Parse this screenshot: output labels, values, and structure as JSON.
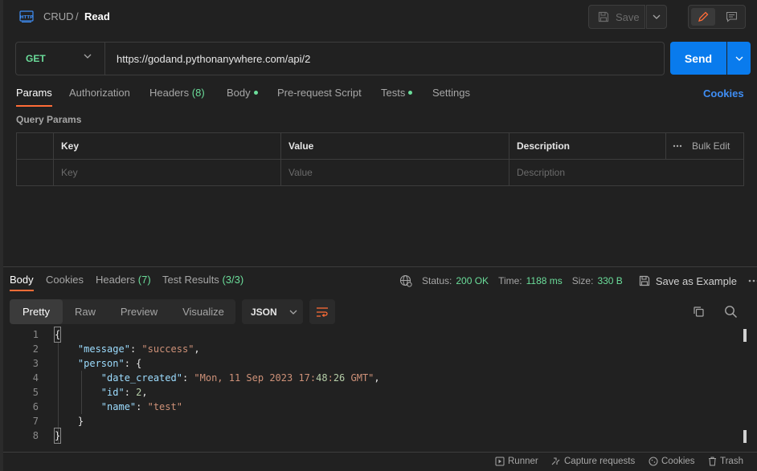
{
  "header": {
    "breadcrumb_parent": "CRUD",
    "breadcrumb_sep": "/",
    "breadcrumb_current": "Read",
    "save_label": "Save"
  },
  "request": {
    "method": "GET",
    "url": "https://godand.pythonanywhere.com/api/2",
    "send_label": "Send"
  },
  "request_tabs": [
    {
      "label": "Params",
      "active": true
    },
    {
      "label": "Authorization"
    },
    {
      "label": "Headers",
      "count": "(8)"
    },
    {
      "label": "Body",
      "dot": true
    },
    {
      "label": "Pre-request Script"
    },
    {
      "label": "Tests",
      "dot": true
    },
    {
      "label": "Settings"
    }
  ],
  "cookies_link": "Cookies",
  "query_params": {
    "title": "Query Params",
    "columns": [
      "Key",
      "Value",
      "Description"
    ],
    "placeholders": [
      "Key",
      "Value",
      "Description"
    ],
    "bulk_edit": "Bulk Edit"
  },
  "response_tabs": [
    {
      "label": "Body",
      "active": true
    },
    {
      "label": "Cookies"
    },
    {
      "label": "Headers",
      "count": "(7)"
    },
    {
      "label": "Test Results",
      "count": "(3/3)"
    }
  ],
  "response_status": {
    "status_label": "Status:",
    "status_value": "200 OK",
    "time_label": "Time:",
    "time_value": "1188 ms",
    "size_label": "Size:",
    "size_value": "330 B",
    "save_example": "Save as Example"
  },
  "view_modes": [
    "Pretty",
    "Raw",
    "Preview",
    "Visualize"
  ],
  "active_view": "Pretty",
  "format": "JSON",
  "code_lines": [
    {
      "n": "1",
      "text": "{"
    },
    {
      "n": "2",
      "text": "    \"message\": \"success\","
    },
    {
      "n": "3",
      "text": "    \"person\": {"
    },
    {
      "n": "4",
      "text": "        \"date_created\": \"Mon, 11 Sep 2023 17:48:26 GMT\","
    },
    {
      "n": "5",
      "text": "        \"id\": 2,"
    },
    {
      "n": "6",
      "text": "        \"name\": \"test\""
    },
    {
      "n": "7",
      "text": "    }"
    },
    {
      "n": "8",
      "text": "}"
    }
  ],
  "footer": {
    "runner": "Runner",
    "capture": "Capture requests",
    "cookies": "Cookies",
    "trash": "Trash"
  },
  "colors": {
    "accent": "#ff6c37",
    "send": "#097bed",
    "success": "#6bdd9a",
    "link": "#3f8ef5"
  }
}
